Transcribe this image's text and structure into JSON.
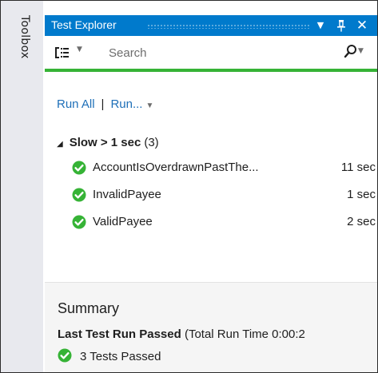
{
  "toolbox": {
    "label": "Toolbox"
  },
  "window": {
    "title": "Test Explorer",
    "dropdown_glyph": "▼",
    "pin_glyph": "📌",
    "close_glyph": "✕"
  },
  "toolbar": {
    "search_placeholder": "Search",
    "group_by_icon": "group-by-icon",
    "search_icon": "search-icon"
  },
  "progress": {
    "fraction": 1.0,
    "color": "#36b336"
  },
  "actions": {
    "run_all": "Run All",
    "separator": "|",
    "run": "Run...",
    "run_arrow": "▼"
  },
  "group": {
    "collapse_glyph": "◢",
    "name": "Slow > 1 sec",
    "count": "(3)"
  },
  "tests": [
    {
      "name": "AccountIsOverdrawnPastThe...",
      "duration": "11 sec",
      "status": "passed"
    },
    {
      "name": "InvalidPayee",
      "duration": "1 sec",
      "status": "passed"
    },
    {
      "name": "ValidPayee",
      "duration": "2 sec",
      "status": "passed"
    }
  ],
  "summary": {
    "title": "Summary",
    "last_run": "Last Test Run Passed",
    "total_time": "(Total Run Time 0:00:2",
    "passed": "3 Tests Passed"
  },
  "colors": {
    "accent": "#007acc",
    "pass_green": "#36b336",
    "link": "#1e6fb8"
  }
}
